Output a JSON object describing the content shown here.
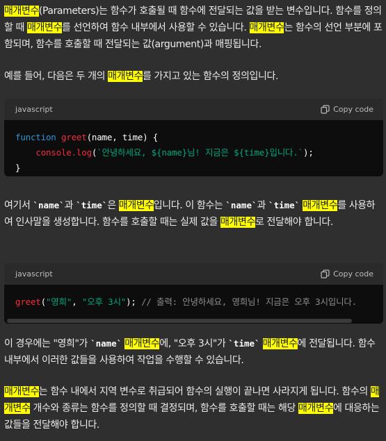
{
  "p1": {
    "a": "매개변수",
    "b": "(Parameters)는 함수가 호출될 때 함수에 전달되는 값을 받는 변수입니다. 함수를 정의할 때 ",
    "c": "매개변수",
    "d": "를 선언하여 함수 내부에서 사용할 수 있습니다. ",
    "e": "매개변수",
    "f": "는 함수의 선언 부분에 포함되며, 함수를 호출할 때 전달되는 값(argument)과 매핑됩니다."
  },
  "p2": {
    "a": "예를 들어, 다음은 두 개의 ",
    "b": "매개변수",
    "c": "를 가지고 있는 함수의 정의입니다."
  },
  "code1": {
    "lang": "javascript",
    "copy": "Copy code",
    "l1_kw": "function",
    "l1_fn": "greet",
    "l1_rest": "(name, time) {",
    "l2_indent": "    ",
    "l2_fn": "console.log",
    "l2_open": "(",
    "l2_str": "`안녕하세요, ${name}님! 지금은 ${time}입니다.`",
    "l2_close": ");",
    "l3": "}"
  },
  "p3": {
    "a": "여기서 ",
    "b": "`name`",
    "c": "과 ",
    "d": "`time`",
    "e": "은 ",
    "f": "매개변수",
    "g": "입니다. 이 함수는 ",
    "h": "`name`",
    "i": "과 ",
    "j": "`time`",
    "k": " ",
    "l": "매개변수",
    "m": "를 사용하여 인사말을 생성합니다. 함수를 호출할 때는 실제 값을 ",
    "n": "매개변수",
    "o": "로 전달해야 합니다."
  },
  "code2": {
    "lang": "javascript",
    "copy": "Copy code",
    "fn": "greet",
    "open": "(",
    "s1": "\"영희\"",
    "comma": ", ",
    "s2": "\"오후 3시\"",
    "close": "); ",
    "comment": "// 출력: 안녕하세요, 영희님! 지금은 오후 3시입니다."
  },
  "p4": {
    "a": "이 경우에는 \"영희\"가 ",
    "b": "`name`",
    "c": " ",
    "d": "매개변수",
    "e": "에, \"오후 3시\"가 ",
    "f": "`time`",
    "g": " ",
    "h": "매개변수",
    "i": "에 전달됩니다. 함수 내부에서 이러한 값들을 사용하여 작업을 수행할 수 있습니다."
  },
  "p5": {
    "a": "매개변수",
    "b": "는 함수 내에서 지역 변수로 취급되어 함수의 실행이 끝나면 사라지게 됩니다. 함수의 ",
    "c": "매개변수",
    "d": " 개수와 종류는 함수를 정의할 때 결정되며, 함수를 호출할 때는 해당 ",
    "e": "매개변수",
    "f": "에 대응하는 값들을 전달해야 합니다."
  },
  "colors": {
    "background": "#2f2f2f",
    "highlight": "#ffff00",
    "code_bg": "#0d0d0d",
    "keyword": "#2e95d3",
    "function": "#f22c3d",
    "string": "#00a67d"
  },
  "icons": {
    "copy": "clipboard-icon"
  }
}
